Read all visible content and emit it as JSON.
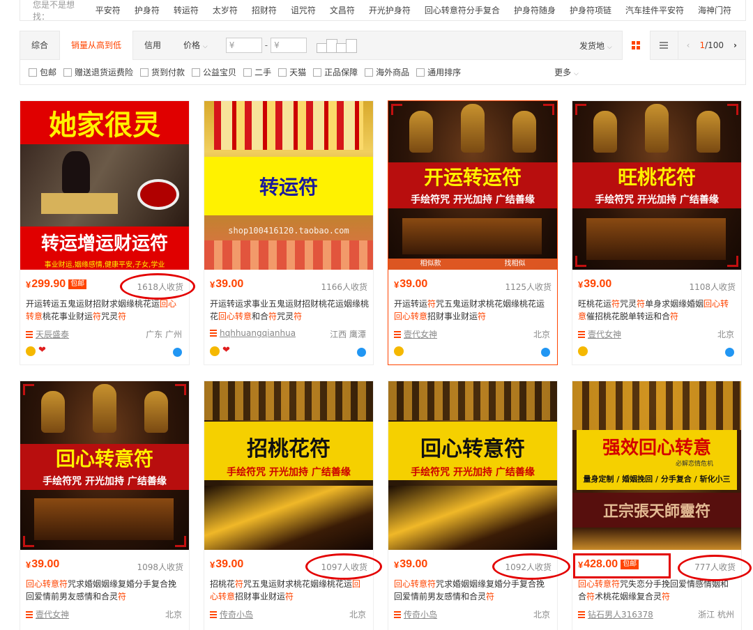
{
  "related": {
    "label": "您是不是想找：",
    "items": [
      "平安符",
      "护身符",
      "转运符",
      "太岁符",
      "招财符",
      "诅咒符",
      "文昌符",
      "开光护身符",
      "回心转意符分手复合",
      "护身符随身",
      "护身符项链",
      "汽车挂件平安符",
      "海神门符"
    ]
  },
  "sortbar": {
    "tabs": [
      "综合",
      "销量从高到低",
      "信用",
      "价格"
    ],
    "price_placeholder": "¥",
    "ship_label": "发货地",
    "page_current": "1",
    "page_total": "/100"
  },
  "filters": {
    "items": [
      "包邮",
      "赠送退货运费险",
      "货到付款",
      "公益宝贝",
      "二手",
      "天猫",
      "正品保障",
      "海外商品",
      "通用排序"
    ],
    "more": "更多"
  },
  "products": [
    {
      "price": "299.90",
      "baoyou": "包邮",
      "sales": "1618人收货",
      "title_parts": [
        [
          "开运转运五鬼运财招财求姻缘桃花运",
          false
        ],
        [
          "回心转",
          true
        ],
        [
          "意",
          true
        ],
        [
          "桃花事业财运",
          false
        ],
        [
          "符",
          true
        ],
        [
          "咒灵",
          false
        ],
        [
          "符",
          true
        ]
      ],
      "shop": "天辰盛泰",
      "loc": "广东 广州",
      "img_top": "她家很灵",
      "img_bottom": "转运增运财运符",
      "img_sub": "事业财运,姻缘感情,健康平安,子女,学业"
    },
    {
      "price": "39.00",
      "sales": "1166人收货",
      "title_parts": [
        [
          "开运转运求事业五鬼运财招财桃花运姻缘桃花",
          false
        ],
        [
          "回心转意",
          true
        ],
        [
          "和合",
          false
        ],
        [
          "符",
          true
        ],
        [
          "咒灵",
          false
        ],
        [
          "符",
          true
        ]
      ],
      "shop": "hqhhuangqianhua",
      "loc": "江西 鹰潭",
      "img_text": "转运符",
      "img_watermark": "shop100416120.taobao.com"
    },
    {
      "price": "39.00",
      "sales": "1125人收货",
      "title_parts": [
        [
          "开运转运",
          false
        ],
        [
          "符",
          true
        ],
        [
          "咒五鬼运财求桃花姻缘桃花运",
          false
        ],
        [
          "回心转意",
          true
        ],
        [
          "招财事业财运",
          false
        ],
        [
          "符",
          true
        ]
      ],
      "shop": "壹代女神",
      "loc": "北京",
      "img_text": "开运转运符",
      "img_sub": "手绘符咒 开光加持 广结善缘",
      "img_tag1": "相似款",
      "img_tag2": "找相似"
    },
    {
      "price": "39.00",
      "sales": "1108人收货",
      "title_parts": [
        [
          "旺桃花运",
          false
        ],
        [
          "符",
          true
        ],
        [
          "咒灵",
          false
        ],
        [
          "符",
          true
        ],
        [
          "单身求姻缘婚姻",
          false
        ],
        [
          "回心转意",
          true
        ],
        [
          "催招桃花脱单转运和合",
          false
        ],
        [
          "符",
          true
        ]
      ],
      "shop": "壹代女神",
      "loc": "北京",
      "img_text": "旺桃花符",
      "img_sub": "手绘符咒 开光加持 广结善缘"
    },
    {
      "price": "39.00",
      "sales": "1098人收货",
      "title_parts": [
        [
          "回心转意符",
          true
        ],
        [
          "咒求婚姻姻缘复婚分手复合挽回爱情前男友感情和合灵",
          false
        ],
        [
          "符",
          true
        ]
      ],
      "shop": "壹代女神",
      "loc": "北京",
      "img_text": "回心转意符",
      "img_sub": "手绘符咒 开光加持 广结善缘"
    },
    {
      "price": "39.00",
      "sales": "1097人收货",
      "title_parts": [
        [
          "招桃花",
          false
        ],
        [
          "符",
          true
        ],
        [
          "咒五鬼运财求桃花姻缘桃花运",
          false
        ],
        [
          "回心转意",
          true
        ],
        [
          "招财事业财运",
          false
        ],
        [
          "符",
          true
        ]
      ],
      "shop": "传奇小岛",
      "loc": "北京",
      "img_text": "招桃花符",
      "img_sub": "手绘符咒 开光加持 广结善缘"
    },
    {
      "price": "39.00",
      "sales": "1092人收货",
      "title_parts": [
        [
          "回心转意符",
          true
        ],
        [
          "咒求婚姻姻缘复婚分手复合挽回爱情前男友感情和合灵",
          false
        ],
        [
          "符",
          true
        ]
      ],
      "shop": "传奇小岛",
      "loc": "北京",
      "img_text": "回心转意符",
      "img_sub": "手绘符咒 开光加持 广结善缘"
    },
    {
      "price": "428.00",
      "baoyou": "包邮",
      "sales": "777人收货",
      "title_parts": [
        [
          "回心转意符",
          true
        ],
        [
          "咒失恋分手挽回爱情感情姻和合",
          false
        ],
        [
          "符",
          true
        ],
        [
          "术桃花姻缘复合灵",
          false
        ],
        [
          "符",
          true
        ]
      ],
      "shop": "钻石男人316378",
      "loc": "浙江 杭州",
      "img_text": "强效回心转意",
      "img_small": "必解恋情危机",
      "img_sub": "量身定制 / 婚姻挽回 / 分手复合 / 斩化小三",
      "img_banner": "正宗張天師靈符"
    }
  ],
  "colors": {
    "accent": "#ff4400",
    "highlight": "#e30000"
  }
}
